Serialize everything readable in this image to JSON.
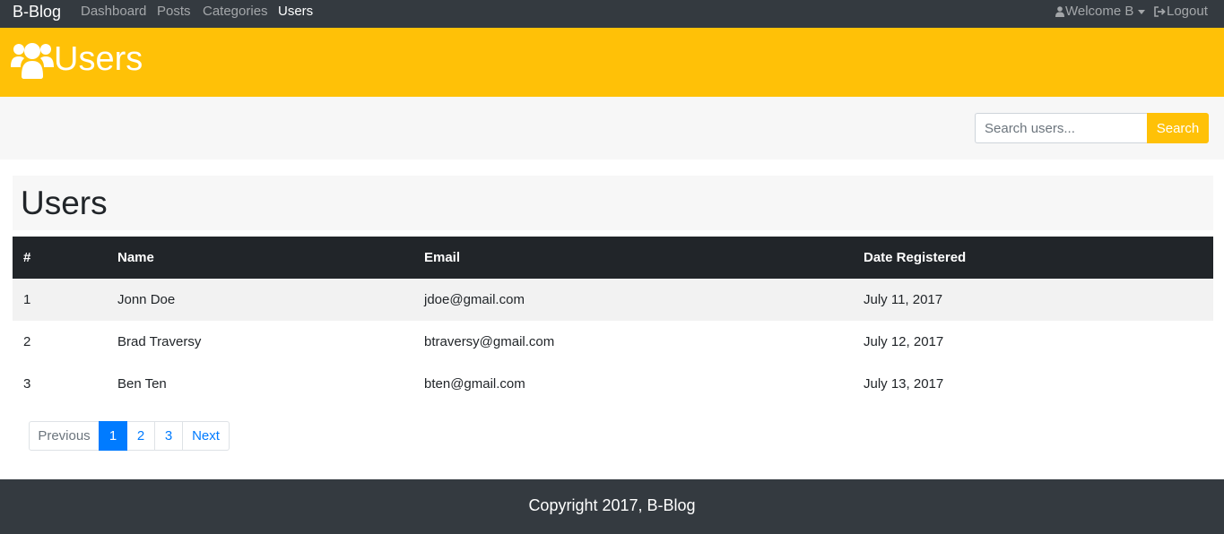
{
  "navbar": {
    "brand": "B-Blog",
    "links": [
      {
        "label": "Dashboard"
      },
      {
        "label": "Posts"
      },
      {
        "label": "Categories"
      },
      {
        "label": "Users",
        "active": true
      }
    ],
    "welcome": "Welcome B",
    "logout": "Logout"
  },
  "header": {
    "title": "Users",
    "icon": "users-icon",
    "color": "#ffc107"
  },
  "search": {
    "placeholder": "Search users...",
    "value": "",
    "button_label": "Search"
  },
  "page": {
    "title": "Users"
  },
  "table": {
    "columns": [
      "#",
      "Name",
      "Email",
      "Date Registered"
    ],
    "rows": [
      [
        "1",
        "Jonn Doe",
        "jdoe@gmail.com",
        "July 11, 2017"
      ],
      [
        "2",
        "Brad Traversy",
        "btraversy@gmail.com",
        "July 12, 2017"
      ],
      [
        "3",
        "Ben Ten",
        "bten@gmail.com",
        "July 13, 2017"
      ]
    ]
  },
  "pagination": {
    "previous": "Previous",
    "pages": [
      "1",
      "2",
      "3"
    ],
    "current": "1",
    "next": "Next"
  },
  "footer": {
    "text": "Copyright 2017, B-Blog"
  },
  "colors": {
    "navbar": "#343a40",
    "accent": "#ffc107",
    "primary": "#007bff",
    "table_header": "#212529"
  }
}
